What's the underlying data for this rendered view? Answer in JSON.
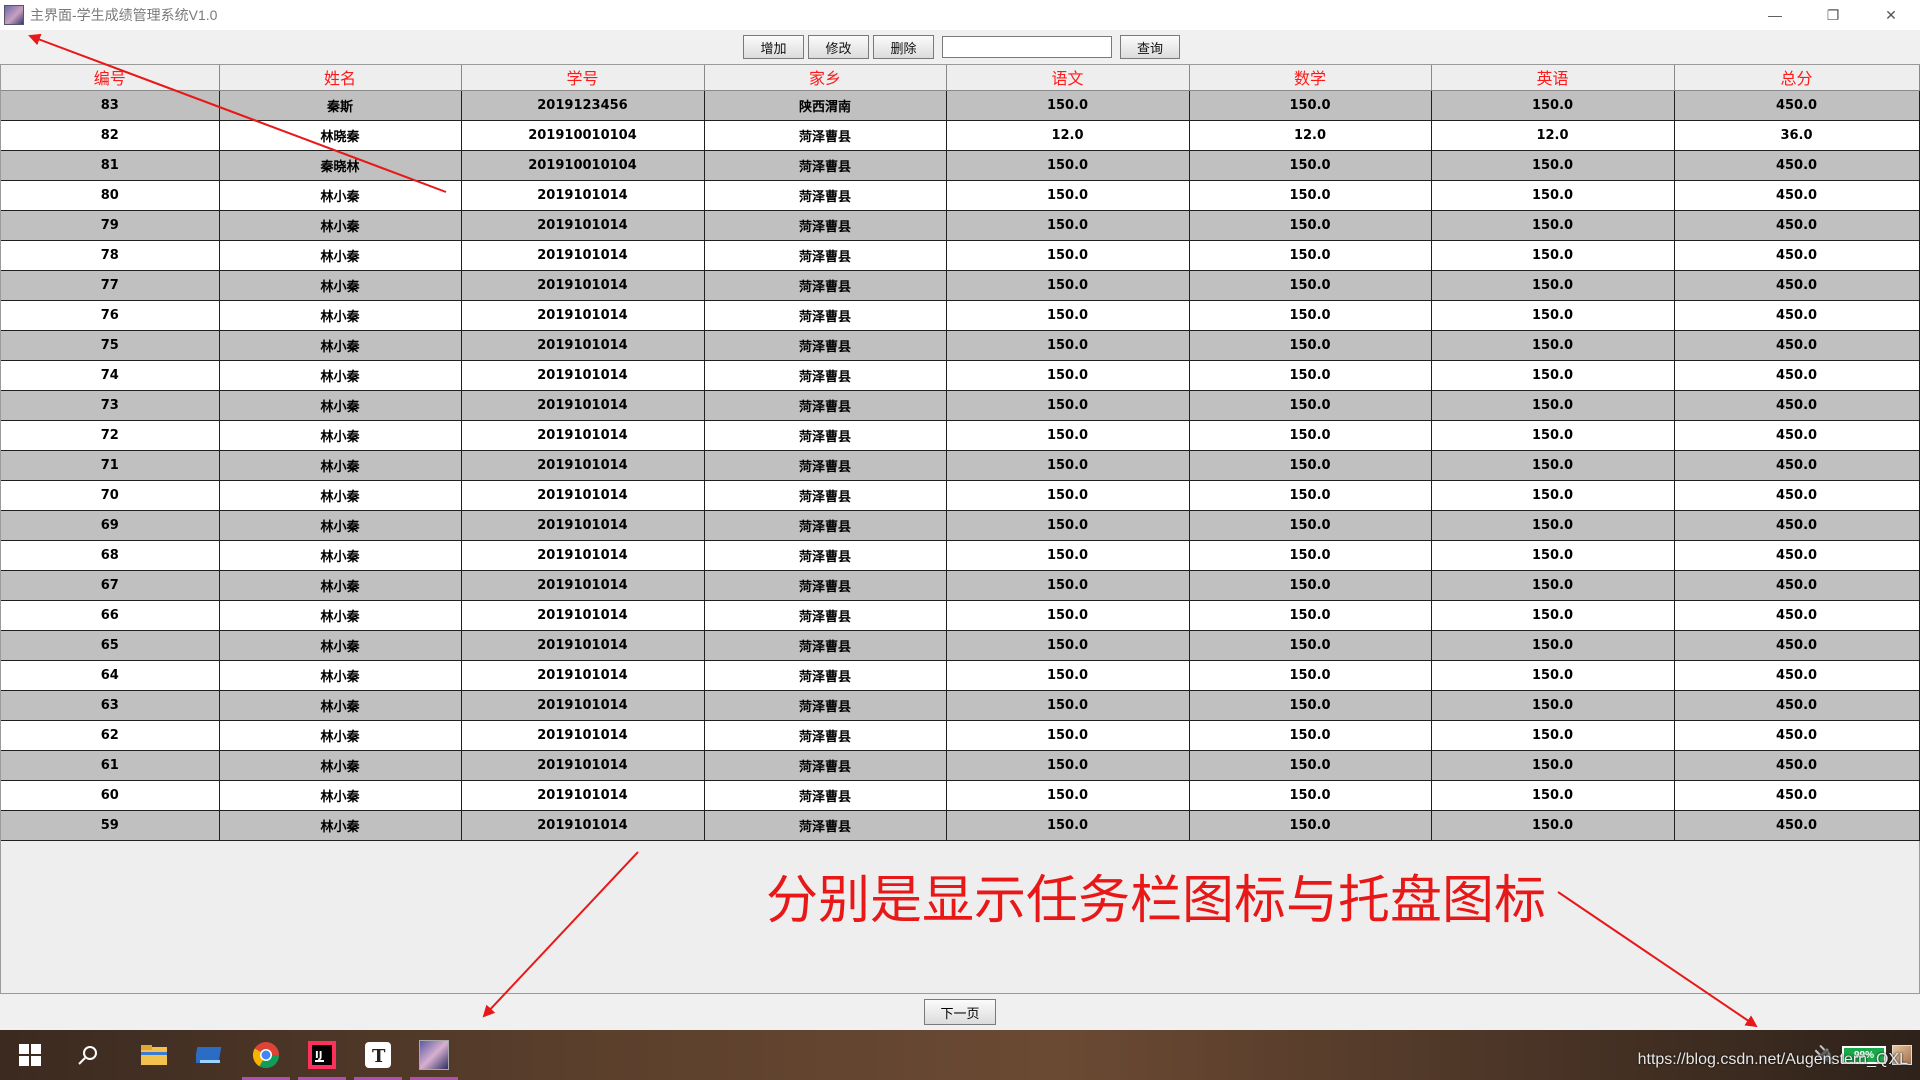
{
  "window": {
    "title": "主界面-学生成绩管理系统V1.0",
    "icon": "app-avatar-icon",
    "controls": [
      "—",
      "❐",
      "✕"
    ]
  },
  "toolbar": {
    "add_label": "增加",
    "edit_label": "修改",
    "delete_label": "删除",
    "search_value": "",
    "query_label": "查询"
  },
  "table": {
    "headers": [
      "编号",
      "姓名",
      "学号",
      "家乡",
      "语文",
      "数学",
      "英语",
      "总分"
    ],
    "rows": [
      [
        "83",
        "秦斯",
        "2019123456",
        "陕西渭南",
        "150.0",
        "150.0",
        "150.0",
        "450.0"
      ],
      [
        "82",
        "林晓秦",
        "201910010104",
        "菏泽曹县",
        "12.0",
        "12.0",
        "12.0",
        "36.0"
      ],
      [
        "81",
        "秦晓林",
        "201910010104",
        "菏泽曹县",
        "150.0",
        "150.0",
        "150.0",
        "450.0"
      ],
      [
        "80",
        "林小秦",
        "2019101014",
        "菏泽曹县",
        "150.0",
        "150.0",
        "150.0",
        "450.0"
      ],
      [
        "79",
        "林小秦",
        "2019101014",
        "菏泽曹县",
        "150.0",
        "150.0",
        "150.0",
        "450.0"
      ],
      [
        "78",
        "林小秦",
        "2019101014",
        "菏泽曹县",
        "150.0",
        "150.0",
        "150.0",
        "450.0"
      ],
      [
        "77",
        "林小秦",
        "2019101014",
        "菏泽曹县",
        "150.0",
        "150.0",
        "150.0",
        "450.0"
      ],
      [
        "76",
        "林小秦",
        "2019101014",
        "菏泽曹县",
        "150.0",
        "150.0",
        "150.0",
        "450.0"
      ],
      [
        "75",
        "林小秦",
        "2019101014",
        "菏泽曹县",
        "150.0",
        "150.0",
        "150.0",
        "450.0"
      ],
      [
        "74",
        "林小秦",
        "2019101014",
        "菏泽曹县",
        "150.0",
        "150.0",
        "150.0",
        "450.0"
      ],
      [
        "73",
        "林小秦",
        "2019101014",
        "菏泽曹县",
        "150.0",
        "150.0",
        "150.0",
        "450.0"
      ],
      [
        "72",
        "林小秦",
        "2019101014",
        "菏泽曹县",
        "150.0",
        "150.0",
        "150.0",
        "450.0"
      ],
      [
        "71",
        "林小秦",
        "2019101014",
        "菏泽曹县",
        "150.0",
        "150.0",
        "150.0",
        "450.0"
      ],
      [
        "70",
        "林小秦",
        "2019101014",
        "菏泽曹县",
        "150.0",
        "150.0",
        "150.0",
        "450.0"
      ],
      [
        "69",
        "林小秦",
        "2019101014",
        "菏泽曹县",
        "150.0",
        "150.0",
        "150.0",
        "450.0"
      ],
      [
        "68",
        "林小秦",
        "2019101014",
        "菏泽曹县",
        "150.0",
        "150.0",
        "150.0",
        "450.0"
      ],
      [
        "67",
        "林小秦",
        "2019101014",
        "菏泽曹县",
        "150.0",
        "150.0",
        "150.0",
        "450.0"
      ],
      [
        "66",
        "林小秦",
        "2019101014",
        "菏泽曹县",
        "150.0",
        "150.0",
        "150.0",
        "450.0"
      ],
      [
        "65",
        "林小秦",
        "2019101014",
        "菏泽曹县",
        "150.0",
        "150.0",
        "150.0",
        "450.0"
      ],
      [
        "64",
        "林小秦",
        "2019101014",
        "菏泽曹县",
        "150.0",
        "150.0",
        "150.0",
        "450.0"
      ],
      [
        "63",
        "林小秦",
        "2019101014",
        "菏泽曹县",
        "150.0",
        "150.0",
        "150.0",
        "450.0"
      ],
      [
        "62",
        "林小秦",
        "2019101014",
        "菏泽曹县",
        "150.0",
        "150.0",
        "150.0",
        "450.0"
      ],
      [
        "61",
        "林小秦",
        "2019101014",
        "菏泽曹县",
        "150.0",
        "150.0",
        "150.0",
        "450.0"
      ],
      [
        "60",
        "林小秦",
        "2019101014",
        "菏泽曹县",
        "150.0",
        "150.0",
        "150.0",
        "450.0"
      ],
      [
        "59",
        "林小秦",
        "2019101014",
        "菏泽曹县",
        "150.0",
        "150.0",
        "150.0",
        "450.0"
      ]
    ]
  },
  "pager": {
    "next_label": "下一页"
  },
  "annotation": {
    "text": "分别是显示任务栏图标与托盘图标",
    "color": "#e81818"
  },
  "taskbar": {
    "items": [
      "windows-start-icon",
      "search-icon",
      "file-explorer-icon",
      "terminal-icon",
      "chrome-icon",
      "intellij-idea-icon",
      "typora-icon",
      "app-avatar-icon"
    ],
    "battery_label": "99%",
    "watermark": "https://blog.csdn.net/Augenstern_QXL"
  },
  "colors": {
    "header_text": "#ff1a1a",
    "row_odd": "#c0c0c0",
    "row_even": "#ffffff",
    "taskbar_accent": "#b04fb0"
  }
}
